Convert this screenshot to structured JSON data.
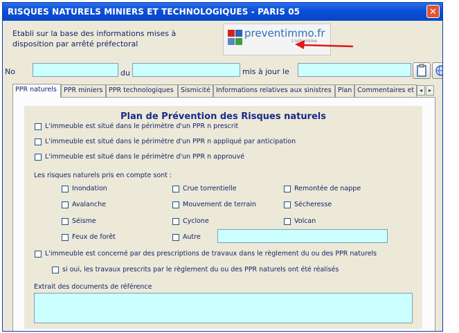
{
  "window": {
    "title": "RISQUES NATURELS MINIERS ET TECHNOLOGIQUES - PARIS 05",
    "close_label": "✕"
  },
  "info_text": "Etabli sur la base des informations mises à disposition par arrêté préfectoral",
  "logo": {
    "brand": "preventimmo.fr",
    "tagline": "L'urbanisme"
  },
  "header_fields": {
    "no_label": "No",
    "du_label": "du",
    "maj_label": "mis à jour le"
  },
  "tabs": [
    "PPR naturels",
    "PPR miniers",
    "PPR technologiques",
    "Sismicité",
    "Informations relatives aux sinistres",
    "Plan",
    "Commentaires et"
  ],
  "panel": {
    "heading": "Plan de Prévention des Risques naturels",
    "status_options": [
      "L'immeuble est situé dans le périmètre d'un PPR n prescrit",
      "L'immeuble est situé dans le périmètre d'un PPR n appliqué par anticipation",
      "L'immeuble est situé dans le périmètre d'un PPR n approuvé"
    ],
    "risks_label": "Les risques naturels pris en compte sont :",
    "risks": [
      [
        "Inondation",
        "Crue torrentielle",
        "Remontée de nappe"
      ],
      [
        "Avalanche",
        "Mouvement de terrain",
        "Sécheresse"
      ],
      [
        "Séisme",
        "Cyclone",
        "Volcan"
      ],
      [
        "Feux de forêt",
        "Autre"
      ]
    ],
    "prescriptions_label": "L'immeuble est concerné par des prescriptions de travaux dans le règlement du ou des PPR naturels",
    "works_done_label": "si oui, les travaux prescrits par le règlement du ou des PPR naturels ont été réalisés",
    "extract_label": "Extrait des documents de référence"
  },
  "colors": {
    "field_bg": "#ccffff",
    "titlebar": "#0a4fd8",
    "text": "#15226a"
  }
}
